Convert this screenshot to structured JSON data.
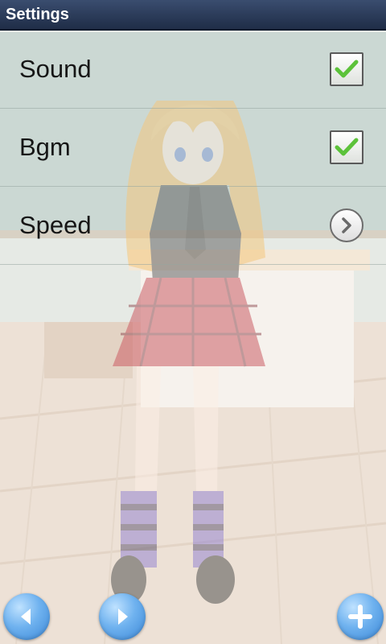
{
  "title": "Settings",
  "settings": [
    {
      "label": "Sound",
      "control": "checkbox",
      "checked": true
    },
    {
      "label": "Bgm",
      "control": "checkbox",
      "checked": true
    },
    {
      "label": "Speed",
      "control": "arrow"
    }
  ],
  "icons": {
    "check": "check-icon",
    "arrow": "chevron-right-icon",
    "prev": "arrow-left-icon",
    "next": "arrow-right-icon",
    "add": "plus-icon"
  },
  "colors": {
    "titlebar": "#2c3b59",
    "check": "#5cc23a",
    "button_blue": "#4a95e0",
    "label_text": "#161616"
  }
}
